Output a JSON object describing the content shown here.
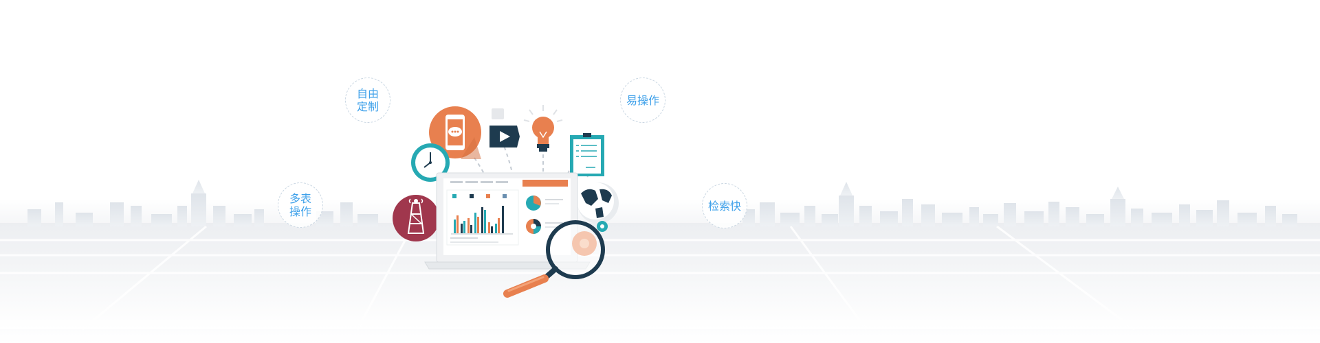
{
  "features": {
    "custom": "自由\n定制",
    "easy": "易操作",
    "multi": "多表\n操作",
    "search": "检索快"
  },
  "colors": {
    "accent_text": "#3fa1ea",
    "orange": "#e8804f",
    "teal": "#26a9b3",
    "navy": "#1e3b4f",
    "maroon": "#a0374d"
  },
  "icons": [
    "phone-chat-icon",
    "video-play-icon",
    "lightbulb-icon",
    "clipboard-icon",
    "clock-icon",
    "signal-tower-icon",
    "globe-icon",
    "gear-icon",
    "magnifier-icon",
    "laptop-dashboard-illustration",
    "city-skyline"
  ]
}
